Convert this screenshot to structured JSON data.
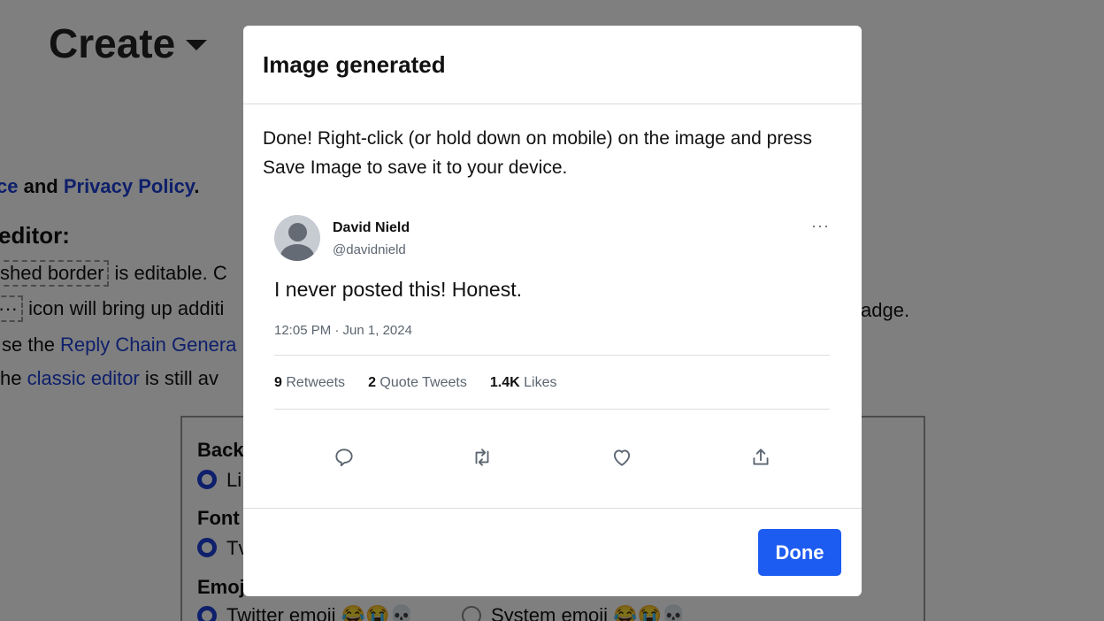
{
  "background": {
    "create_title": "Create",
    "policy_line": {
      "prefix": "ce",
      "middle": " and ",
      "link": "Privacy Policy",
      "suffix": "."
    },
    "editor_heading": "editor:",
    "lines": {
      "l1_boxed": "shed border",
      "l1_rest": " is editable. C",
      "l2_boxed": "···",
      "l2_rest": " icon will bring up additi",
      "l2_far": "adge.",
      "l3_pre": "se the ",
      "l3_link": "Reply Chain Genera",
      "l4_pre": "he ",
      "l4_link": "classic editor",
      "l4_rest": " is still av"
    },
    "settings": {
      "background_label": "Back",
      "background_option": "Li",
      "font_label": "Font",
      "font_option": "Tv",
      "emoji_label": "Emoj",
      "emoji_option_1": "Twitter emoji 😂😭💀",
      "emoji_option_2": "System emoji 😂😭💀"
    }
  },
  "modal": {
    "title": "Image generated",
    "message": "Done! Right-click (or hold down on mobile) on the image and press Save Image to save it to your device.",
    "done_label": "Done"
  },
  "tweet": {
    "name": "David Nield",
    "handle": "@davidnield",
    "more": "···",
    "text": "I never posted this! Honest.",
    "timestamp": "12:05 PM · Jun 1, 2024",
    "stats": {
      "retweets_count": "9",
      "retweets_label": "Retweets",
      "quotes_count": "2",
      "quotes_label": "Quote Tweets",
      "likes_count": "1.4K",
      "likes_label": "Likes"
    },
    "action_icons": [
      "reply-icon",
      "retweet-icon",
      "like-icon",
      "share-icon"
    ]
  },
  "colors": {
    "accent": "#1d5cf0",
    "link": "#1d3fd6",
    "overlay": "rgba(0,0,0,0.5)",
    "muted_text": "#5c6570"
  }
}
